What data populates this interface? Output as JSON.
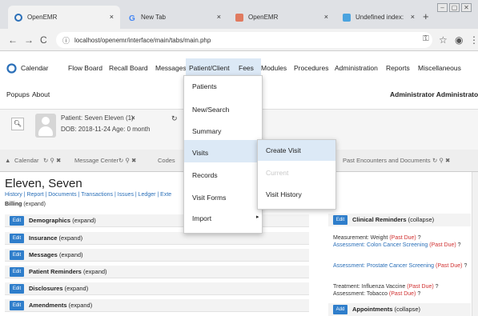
{
  "browser": {
    "tabs": [
      {
        "title": "OpenEMR",
        "close": "×"
      },
      {
        "title": "New Tab",
        "close": "×"
      },
      {
        "title": "OpenEMR",
        "close": "×"
      },
      {
        "title": "Undefined index: basepath",
        "close": "×"
      }
    ],
    "new_tab": "+",
    "url": "localhost/openemr/interface/main/tabs/main.php",
    "window_controls": [
      "–",
      "▢",
      "✕"
    ]
  },
  "menu": {
    "items": [
      "Calendar",
      "Flow Board",
      "Recall Board",
      "Messages",
      "Patient/Client",
      "Fees",
      "Modules",
      "Procedures",
      "Administration",
      "Reports",
      "Miscellaneous"
    ],
    "row2": [
      "Popups",
      "About"
    ],
    "user": "Administrator Administrator"
  },
  "patient": {
    "name_line": "Patient: Seven Eleven (1)",
    "close": "×",
    "dob_line": "DOB: 2018-11-24 Age: 0 month"
  },
  "tabs": {
    "calendar": "Calendar",
    "message_center": "Message Center",
    "codes": "Codes",
    "past_encounters": "Past Encounters and Documents"
  },
  "content": {
    "patient_name": "Eleven, Seven",
    "links": "History | Report | Documents | Transactions | Issues | Ledger | Exte",
    "billing_label": "Billing",
    "billing_expand": "(expand)",
    "edit_label": "Edit",
    "add_label": "Add",
    "sections": [
      {
        "title": "Demographics",
        "toggle": "(expand)"
      },
      {
        "title": "Insurance",
        "toggle": "(expand)"
      },
      {
        "title": "Messages",
        "toggle": "(expand)"
      },
      {
        "title": "Patient Reminders",
        "toggle": "(expand)"
      },
      {
        "title": "Disclosures",
        "toggle": "(expand)"
      },
      {
        "title": "Amendments",
        "toggle": "(expand)"
      }
    ],
    "clinical_reminders": {
      "title": "Clinical Reminders",
      "toggle": "(collapse)"
    },
    "reminders": [
      {
        "text": "Measurement: Weight",
        "status": "(Past Due)",
        "q": "?"
      },
      {
        "text": "Assessment: Colon Cancer Screening",
        "status": "(Past Due)",
        "q": "?"
      },
      {
        "text": "Assessment: Prostate Cancer Screening",
        "status": "(Past Due)",
        "q": "?"
      },
      {
        "text": "Treatment: Influenza Vaccine",
        "status": "(Past Due)",
        "q": "?"
      },
      {
        "text": "Assessment: Tobacco",
        "status": "(Past Due)",
        "q": "?"
      }
    ],
    "appointments": {
      "title": "Appointments",
      "toggle": "(collapse)"
    }
  },
  "dropdown_patient": {
    "items": [
      "Patients",
      "New/Search",
      "Summary",
      "Visits",
      "Records",
      "Visit Forms",
      "Import"
    ]
  },
  "dropdown_visits": {
    "items": [
      "Create Visit",
      "Current",
      "Visit History"
    ]
  },
  "colors": {
    "accent": "#2f7ecb",
    "highlight": "#dce9f6",
    "past_due": "#d03030"
  }
}
